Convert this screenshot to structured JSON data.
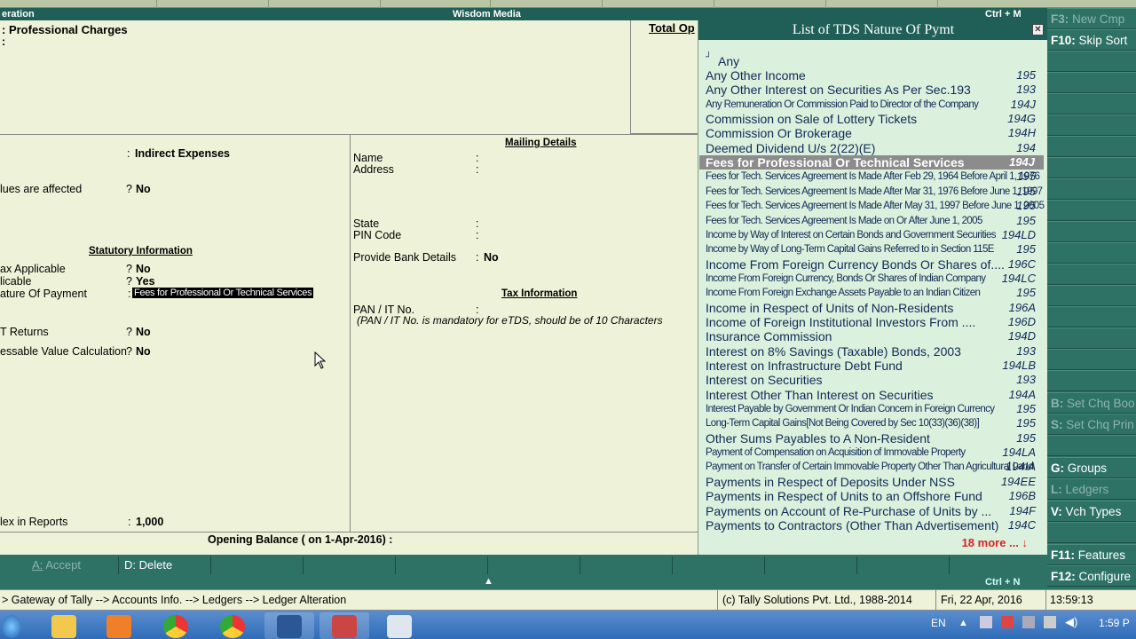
{
  "title_bar": {
    "left": "eration",
    "center": "Wisdom Media",
    "shortcut": "Ctrl + M"
  },
  "header": {
    "ledger_name": "Professional Charges",
    "total_label": "Total Op"
  },
  "left_panel": {
    "under_value": "Indirect Expenses",
    "inventory_label": "lues are affected",
    "inventory_value": "No",
    "statutory_heading": "Statutory Information",
    "tax_applicable_label": "ax Applicable",
    "tax_applicable_value": "No",
    "applicable_label": "licable",
    "applicable_value": "Yes",
    "nature_label": "ature Of Payment",
    "nature_value": "Fees for Professional Or Technical Services",
    "returns_label": "T Returns",
    "returns_value": "No",
    "assessable_label": "essable Value Calculation",
    "assessable_value": "No",
    "index_label": "lex in Reports",
    "index_value": "1,000"
  },
  "mailing": {
    "heading": "Mailing Details",
    "name_label": "Name",
    "address_label": "Address",
    "state_label": "State",
    "pin_label": "PIN Code",
    "bank_label": "Provide Bank Details",
    "bank_value": "No",
    "tax_heading": "Tax Information",
    "pan_label": "PAN / IT No.",
    "pan_note": "(PAN / IT No. is mandatory for eTDS, should be of 10 Characters"
  },
  "opening_balance": "Opening Balance  ( on 1-Apr-2016) :",
  "popup": {
    "title": "List of TDS Nature Of Pymt",
    "first": "Any",
    "items": [
      {
        "name": "Any Other Income",
        "code": "195"
      },
      {
        "name": "Any Other Interest on Securities As Per Sec.193",
        "code": "193"
      },
      {
        "name": "Any Remuneration Or Commission Paid to Director of the Company",
        "code": "194J"
      },
      {
        "name": "Commission on Sale of Lottery Tickets",
        "code": "194G"
      },
      {
        "name": "Commission Or Brokerage",
        "code": "194H"
      },
      {
        "name": "Deemed Dividend U/s 2(22)(E)",
        "code": "194"
      },
      {
        "name": "Fees for Professional Or Technical Services",
        "code": "194J"
      },
      {
        "name": "Fees for Tech. Services Agreement Is Made After Feb 29, 1964 Before April 1, 1976",
        "code": "195"
      },
      {
        "name": "Fees for Tech. Services Agreement Is Made After Mar 31, 1976 Before June 1, 1997",
        "code": "195"
      },
      {
        "name": "Fees for Tech. Services Agreement Is Made After May 31, 1997 Before June 1, 2005",
        "code": "195"
      },
      {
        "name": "Fees for Tech. Services Agreement Is Made on Or After June 1, 2005",
        "code": "195"
      },
      {
        "name": "Income by Way of Interest on Certain Bonds and Government Securities",
        "code": "194LD"
      },
      {
        "name": "Income by Way of Long-Term Capital Gains Referred to in Section 115E",
        "code": "195"
      },
      {
        "name": "Income From Foreign Currency Bonds Or Shares of....",
        "code": "196C"
      },
      {
        "name": "Income From Foreign Currency, Bonds Or Shares of Indian Company",
        "code": "194LC"
      },
      {
        "name": "Income From Foreign Exchange Assets Payable to an Indian Citizen",
        "code": "195"
      },
      {
        "name": "Income in Respect of Units of Non-Residents",
        "code": "196A"
      },
      {
        "name": "Income of Foreign Institutional Investors From ....",
        "code": "196D"
      },
      {
        "name": "Insurance Commission",
        "code": "194D"
      },
      {
        "name": "Interest on 8% Savings (Taxable) Bonds, 2003",
        "code": "193"
      },
      {
        "name": "Interest on Infrastructure Debt Fund",
        "code": "194LB"
      },
      {
        "name": "Interest on Securities",
        "code": "193"
      },
      {
        "name": "Interest Other Than Interest on Securities",
        "code": "194A"
      },
      {
        "name": "Interest Payable by Government Or Indian Concern in Foreign Currency",
        "code": "195"
      },
      {
        "name": "Long-Term Capital Gains[Not Being Covered by Sec 10(33)(36)(38)]",
        "code": "195"
      },
      {
        "name": "Other Sums Payables to A Non-Resident",
        "code": "195"
      },
      {
        "name": "Payment of Compensation on Acquisition of Immovable Property",
        "code": "194LA"
      },
      {
        "name": "Payment on Transfer of Certain Immovable Property Other Than Agricultural Land",
        "code": "194IA"
      },
      {
        "name": "Payments in Respect of Deposits Under NSS",
        "code": "194EE"
      },
      {
        "name": "Payments in Respect of Units to an Offshore Fund",
        "code": "196B"
      },
      {
        "name": "Payments on Account of Re-Purchase of Units by ...",
        "code": "194F"
      },
      {
        "name": "Payments to Contractors (Other Than Advertisement)",
        "code": "194C"
      }
    ],
    "selected_index": 6,
    "more": "18 more ... ↓"
  },
  "right_buttons": [
    {
      "key": "F3:",
      "label": "New Cmp",
      "enabled": false
    },
    {
      "key": "F10:",
      "label": "Skip Sort",
      "enabled": true
    },
    {
      "key": "B:",
      "label": "Set Chq Boo",
      "enabled": false
    },
    {
      "key": "S:",
      "label": "Set Chq Prin",
      "enabled": false
    },
    {
      "key": "G:",
      "label": "Groups",
      "enabled": true
    },
    {
      "key": "L:",
      "label": "Ledgers",
      "enabled": false
    },
    {
      "key": "V:",
      "label": "Vch Types",
      "enabled": true
    },
    {
      "key": "F11:",
      "label": "Features",
      "enabled": true
    },
    {
      "key": "F12:",
      "label": "Configure",
      "enabled": true
    }
  ],
  "bottom_buttons": {
    "accept_key": "A:",
    "accept": "Accept",
    "delete_key": "D:",
    "delete": "Delete"
  },
  "thin_bar": {
    "shortcut": "Ctrl + N"
  },
  "status": {
    "path": "> Gateway of Tally --> Accounts Info. --> Ledgers --> Ledger Alteration",
    "copyright": "(c) Tally Solutions Pvt. Ltd., 1988-2014",
    "date": "Fri, 22 Apr, 2016",
    "time": "13:59:13"
  },
  "taskbar": {
    "lang": "EN",
    "clock": "1:59 P"
  }
}
